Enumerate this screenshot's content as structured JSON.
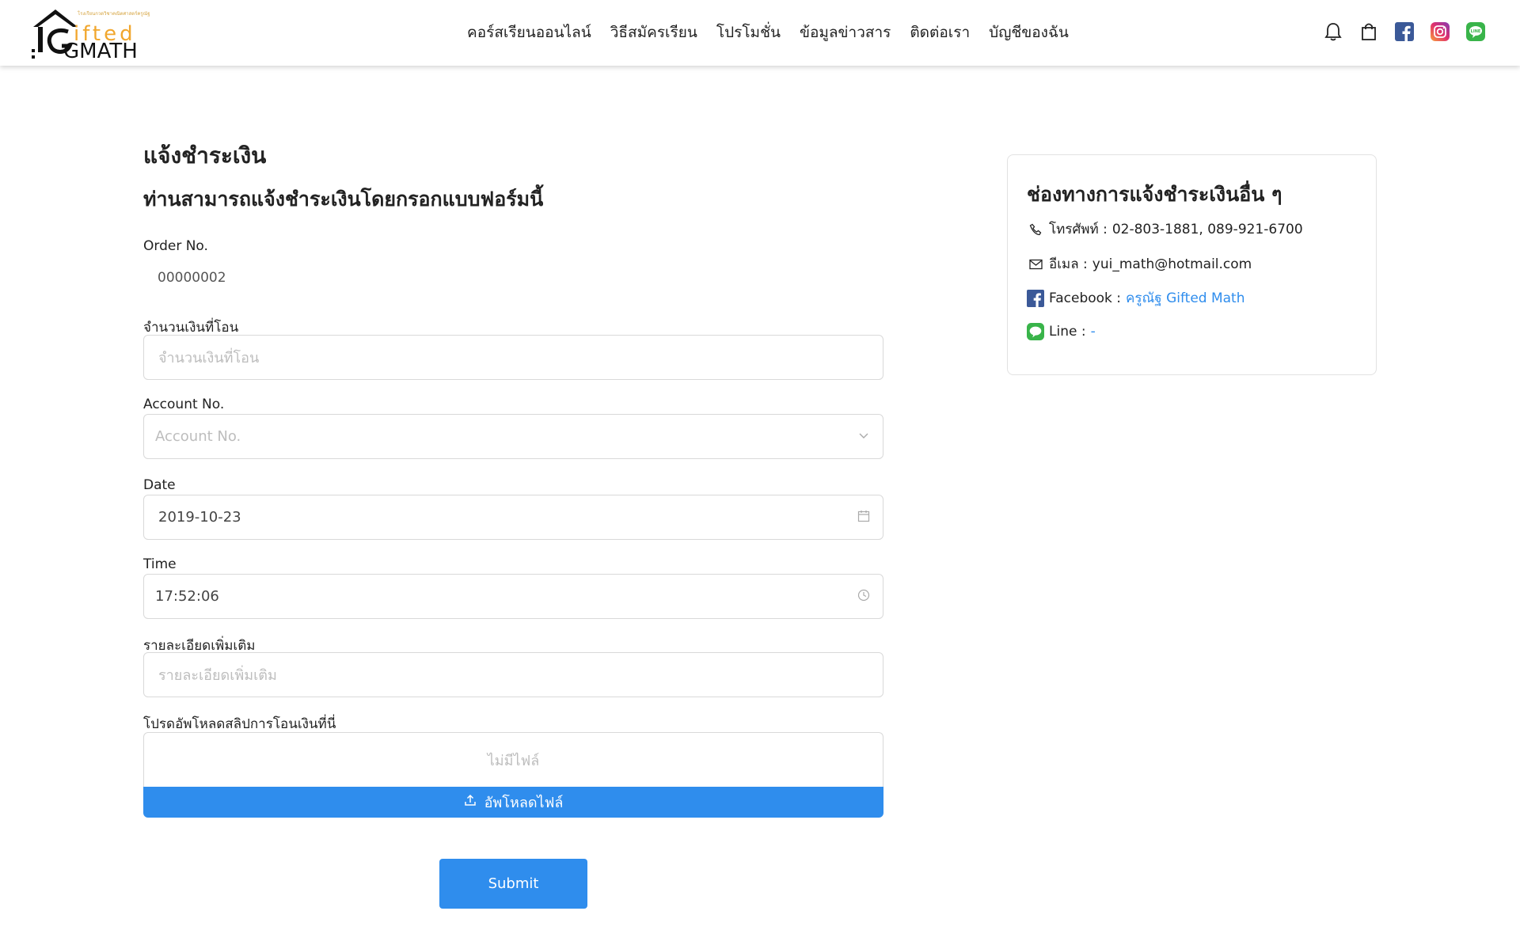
{
  "header": {
    "logo": {
      "tagline": "โรงเรียนกวดวิชาคณิตศาสตร์ครูณัฐ",
      "word1": "ifted",
      "word2": "GMATH"
    },
    "nav": [
      "คอร์สเรียนออนไลน์",
      "วิธีสมัครเรียน",
      "โปรโมชั่น",
      "ข้อมูลข่าวสาร",
      "ติดต่อเรา",
      "บัญชีของฉัน"
    ],
    "icons": [
      "bell-icon",
      "shopping-bag-icon",
      "facebook-icon",
      "instagram-icon",
      "line-icon"
    ],
    "colors": {
      "facebook": "#3b5998",
      "line": "#39b44a"
    }
  },
  "form": {
    "title": "แจ้งชำระเงิน",
    "subtitle": "ท่านสามารถแจ้งชำระเงินโดยกรอกแบบฟอร์มนี้",
    "order_no": {
      "label": "Order No.",
      "value": "00000002"
    },
    "amount": {
      "label": "จำนวนเงินที่โอน",
      "placeholder": "จำนวนเงินที่โอน"
    },
    "account_no": {
      "label": "Account No.",
      "placeholder": "Account No."
    },
    "date": {
      "label": "Date",
      "value": "2019-10-23"
    },
    "time": {
      "label": "Time",
      "value": "17:52:06"
    },
    "details": {
      "label": "รายละเอียดเพิ่มเติม",
      "placeholder": "รายละเอียดเพิ่มเติม"
    },
    "upload": {
      "label": "โปรดอัพโหลดสลิปการโอนเงินที่นี่",
      "empty_text": "ไม่มีไฟล์",
      "button": "อัพโหลดไฟล์"
    },
    "submit": "Submit",
    "accent": "#2f8ded"
  },
  "side": {
    "title": "ช่องทางการแจ้งชำระเงินอื่น ๆ",
    "phone": {
      "label": "โทรศัพท์ :",
      "value": "02-803-1881, 089-921-6700"
    },
    "email": {
      "label": "อีเมล :",
      "value": "yui_math@hotmail.com"
    },
    "facebook": {
      "label": "Facebook :",
      "value": "ครูณัฐ Gifted Math"
    },
    "line": {
      "label": "Line :",
      "value": "-"
    }
  }
}
